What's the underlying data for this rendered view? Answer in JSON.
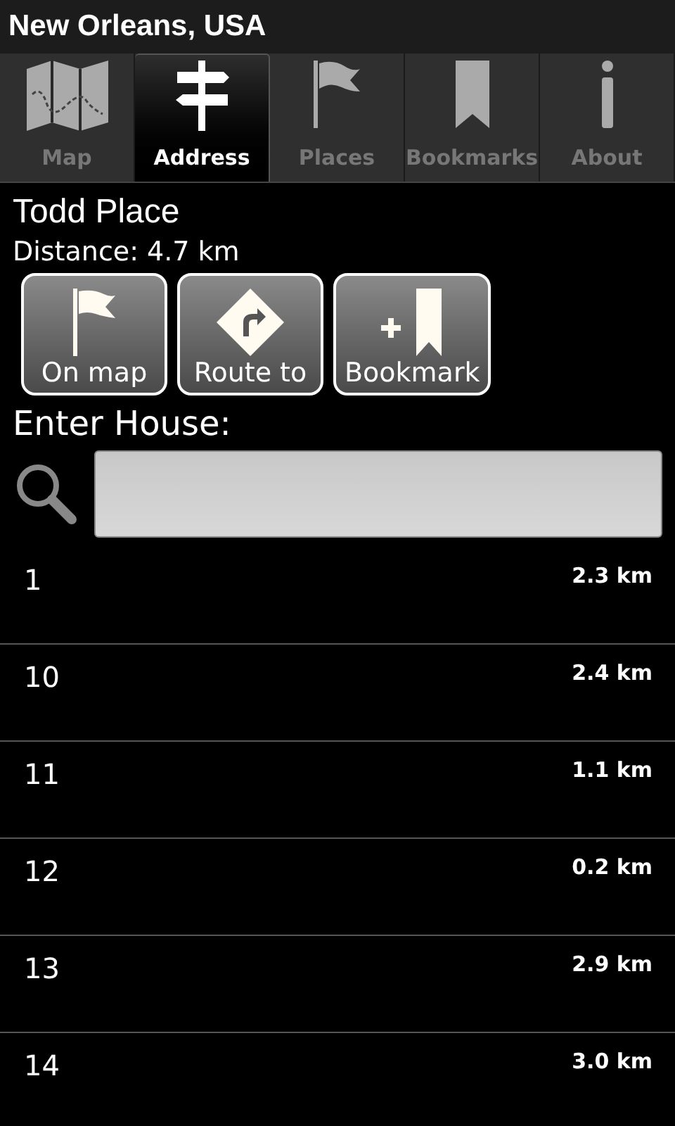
{
  "window": {
    "title": "New Orleans, USA"
  },
  "tabs": [
    {
      "label": "Map",
      "selected": false
    },
    {
      "label": "Address",
      "selected": true
    },
    {
      "label": "Places",
      "selected": false
    },
    {
      "label": "Bookmarks",
      "selected": false
    },
    {
      "label": "About",
      "selected": false
    }
  ],
  "street": {
    "name": "Todd Place",
    "distance": "Distance: 4.7 km"
  },
  "buttons": [
    "On map",
    "Route to",
    "Bookmark"
  ],
  "search": {
    "label": "Enter House:"
  },
  "houses": [
    {
      "number": "1",
      "distance": "2.3 km"
    },
    {
      "number": "10",
      "distance": "2.4 km"
    },
    {
      "number": "11",
      "distance": "1.1 km"
    },
    {
      "number": "12",
      "distance": "0.2 km"
    },
    {
      "number": "13",
      "distance": "2.9 km"
    },
    {
      "number": "14",
      "distance": "3.0 km"
    }
  ]
}
